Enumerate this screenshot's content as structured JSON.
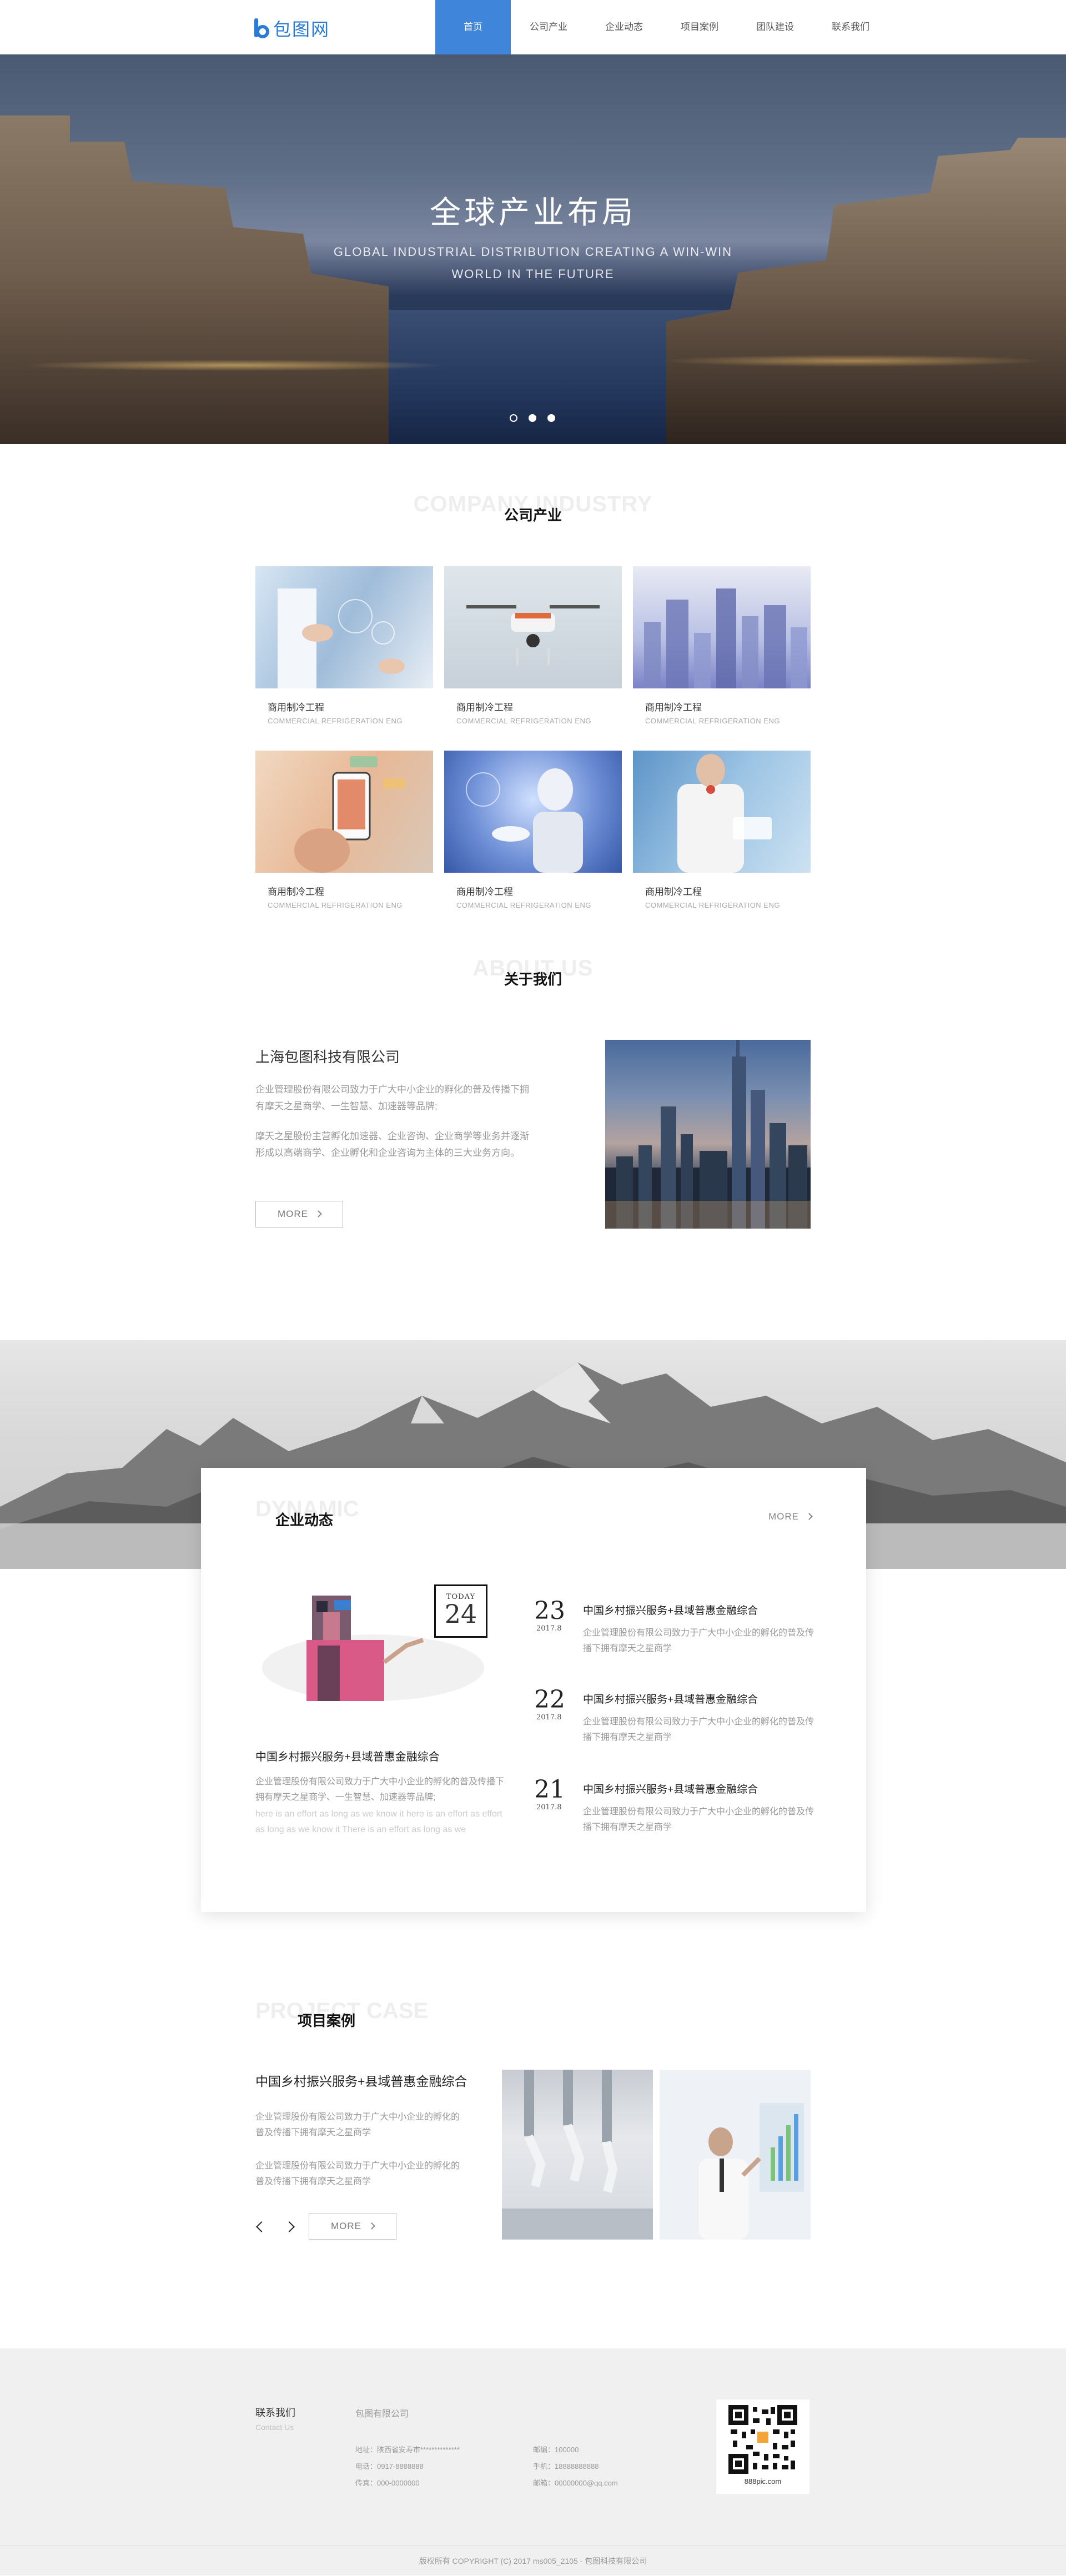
{
  "brand": {
    "logo_text": "包图网",
    "accent": "#2b7bd6",
    "nav_active": "#3f85d9"
  },
  "nav": [
    {
      "label": "首页",
      "active": true
    },
    {
      "label": "公司产业",
      "active": false
    },
    {
      "label": "企业动态",
      "active": false
    },
    {
      "label": "项目案例",
      "active": false
    },
    {
      "label": "团队建设",
      "active": false
    },
    {
      "label": "联系我们",
      "active": false
    }
  ],
  "hero": {
    "title": "全球产业布局",
    "subtitle_line1": "GLOBAL INDUSTRIAL DISTRIBUTION CREATING A WIN-WIN",
    "subtitle_line2": "WORLD IN THE FUTURE",
    "carousel_count": 3,
    "carousel_active": 1
  },
  "industry": {
    "bg_title": "COMPANY INDUSTRY",
    "title": "公司产业",
    "cards": [
      {
        "title": "商用制冷工程",
        "subtitle": "COMMERCIAL REFRIGERATION ENG"
      },
      {
        "title": "商用制冷工程",
        "subtitle": "COMMERCIAL REFRIGERATION ENG"
      },
      {
        "title": "商用制冷工程",
        "subtitle": "COMMERCIAL REFRIGERATION ENG"
      },
      {
        "title": "商用制冷工程",
        "subtitle": "COMMERCIAL REFRIGERATION ENG"
      },
      {
        "title": "商用制冷工程",
        "subtitle": "COMMERCIAL REFRIGERATION ENG"
      },
      {
        "title": "商用制冷工程",
        "subtitle": "COMMERCIAL REFRIGERATION ENG"
      }
    ]
  },
  "about": {
    "bg_title": "ABOUT US",
    "title": "关于我们",
    "company": "上海包图科技有限公司",
    "p1": "企业管理股份有限公司致力于广大中小企业的孵化的普及传播下拥有摩天之星商学、一生智慧、加速器等品牌;",
    "p2": "摩天之星股份主营孵化加速器、企业咨询、企业商学等业务并逐渐形成以高端商学、企业孵化和企业咨询为主体的三大业务方向。",
    "more": "MORE"
  },
  "news": {
    "bg_title": "DYNAMIC",
    "title": "企业动态",
    "more": "MORE",
    "today_label": "TODAY",
    "today_day": "24",
    "feature_title": "中国乡村振兴服务+县域普惠金融综合",
    "feature_p": "企业管理股份有限公司致力于广大中小企业的孵化的普及传播下拥有摩天之星商学、一生智慧、加速器等品牌;",
    "feature_p2": "here is an effort as long as we know it here is an effort as effort as long as we know it There is an effort as long as we",
    "items": [
      {
        "day": "23",
        "ym": "2017.8",
        "title": "中国乡村振兴服务+县域普惠金融综合",
        "text": "企业管理股份有限公司致力于广大中小企业的孵化的普及传播下拥有摩天之星商学"
      },
      {
        "day": "22",
        "ym": "2017.8",
        "title": "中国乡村振兴服务+县域普惠金融综合",
        "text": "企业管理股份有限公司致力于广大中小企业的孵化的普及传播下拥有摩天之星商学"
      },
      {
        "day": "21",
        "ym": "2017.8",
        "title": "中国乡村振兴服务+县域普惠金融综合",
        "text": "企业管理股份有限公司致力于广大中小企业的孵化的普及传播下拥有摩天之星商学"
      }
    ]
  },
  "cases": {
    "bg_title": "PROJECT CASE",
    "title": "项目案例",
    "item_title": "中国乡村振兴服务+县域普惠金融综合",
    "p1": "企业管理股份有限公司致力于广大中小企业的孵化的普及传播下拥有摩天之星商学",
    "p2": "企业管理股份有限公司致力于广大中小企业的孵化的普及传播下拥有摩天之星商学",
    "more": "MORE"
  },
  "footer": {
    "contact_title": "联系我们",
    "contact_sub": "Contact Us",
    "company": "包图有限公司",
    "address": "地址：陕西省安寿市**************",
    "phone": "电话：0917-8888888",
    "fax": "传真：000-0000000",
    "postcode": "邮编：100000",
    "mobile": "手机：18888888888",
    "email": "邮箱：00000000@qq.com",
    "qr_caption": "888pic.com",
    "copyright": "版权所有 COPYRIGHT (C) 2017 ms005_2105 - 包图科技有限公司"
  }
}
